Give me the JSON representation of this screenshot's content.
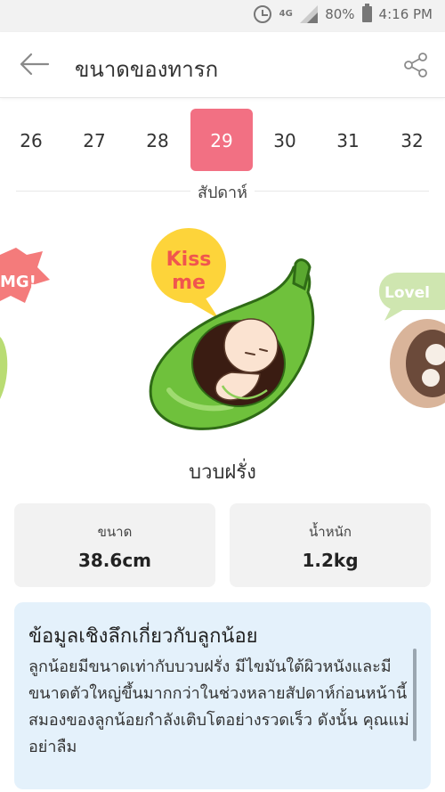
{
  "status_bar": {
    "network": "4G",
    "battery_pct": "80%",
    "time": "4:16 PM"
  },
  "header": {
    "title": "ขนาดของทารก"
  },
  "weeks": {
    "items": [
      "26",
      "27",
      "28",
      "29",
      "30",
      "31",
      "32"
    ],
    "selected": "29",
    "label": "สัปดาห์",
    "active_color": "#f27083"
  },
  "illustration": {
    "left_sticker_text": "MG!",
    "center_bubble_line1": "Kiss",
    "center_bubble_line2": "me",
    "right_sticker_text": "Lovel"
  },
  "fruit": {
    "name": "บวบฝรั่ง"
  },
  "stats": {
    "size": {
      "label": "ขนาด",
      "value": "38.6cm"
    },
    "weight": {
      "label": "น้ำหนัก",
      "value": "1.2kg"
    }
  },
  "insight": {
    "title": "ข้อมูลเชิงลึกเกี่ยวกับลูกน้อย",
    "body": "ลูกน้อยมีขนาดเท่ากับบวบฝรั่ง มีไขมันใต้ผิวหนังและมีขนาดตัวใหญ่ขึ้นมากกว่าในช่วงหลายสัปดาห์ก่อนหน้านี้ สมองของลูกน้อยกำลังเติบโตอย่างรวดเร็ว ดังนั้น คุณแม่อย่าลืม"
  }
}
